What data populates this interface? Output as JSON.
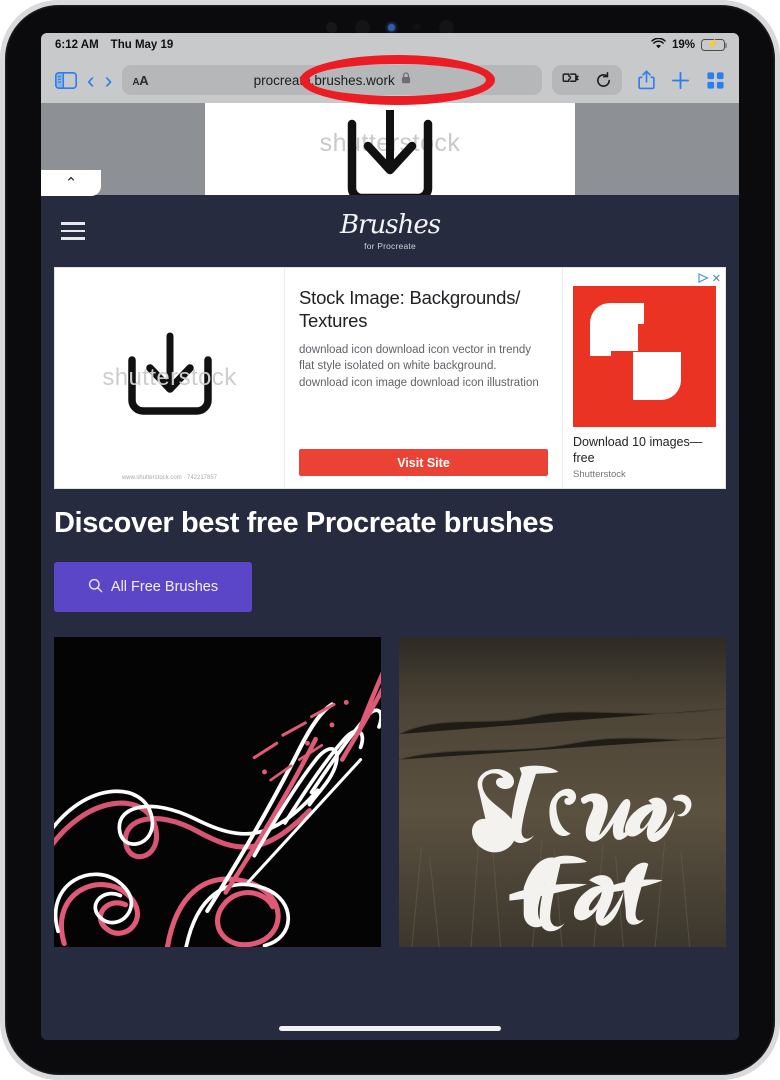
{
  "status_bar": {
    "time": "6:12 AM",
    "date": "Thu May 19",
    "wifi_icon": "wifi-icon",
    "battery_percent": "19%",
    "battery_state": "charging"
  },
  "browser": {
    "sidebar_icon": "sidebar-icon",
    "back_icon": "chevron-left-icon",
    "forward_icon": "chevron-right-icon",
    "text_size_label": "AA",
    "url": "procreate.brushes.work",
    "lock_icon": "lock-icon",
    "extensions_icon": "puzzle-extension-icon",
    "reload_icon": "reload-icon",
    "share_icon": "share-icon",
    "new_tab_icon": "plus-icon",
    "tabs_icon": "tab-overview-icon",
    "annotation": {
      "shape": "ellipse",
      "color": "#ec1c24",
      "target": "url-field"
    }
  },
  "sticky_ad": {
    "watermark": "shutterstock",
    "icon": "download-icon",
    "collapse_icon": "chevron-up-icon"
  },
  "site": {
    "menu_icon": "hamburger-menu-icon",
    "brand_name": "Brushes",
    "brand_subtitle": "for Procreate",
    "headline": "Discover best free Procreate brushes",
    "cta": {
      "label": "All Free Brushes",
      "icon": "search-icon",
      "color": "#5b46c8"
    },
    "background_color": "#262b3f"
  },
  "inline_ad": {
    "image_watermark": "shutterstock",
    "image_caption": "www.shutterstock.com · 742217857",
    "image_icon": "download-icon",
    "title": "Stock Image: Backgrounds/ Textures",
    "description": "download icon download icon vector in trendy flat style isolated on white background. download icon image download icon illustration",
    "cta_label": "Visit Site",
    "cta_color": "#ea4335",
    "right_title": "Download 10 images—free",
    "right_advertiser": "Shutterstock",
    "adchoices_icon": "adchoices-icon",
    "close_icon": "close-icon",
    "logo_color": "#ea3323"
  },
  "cards": [
    {
      "name": "superb-neon-lettering",
      "text": "Superb",
      "style": "neon calligraphy on black"
    },
    {
      "name": "straw-hat-lettering",
      "text_line1": "Straw",
      "text_line2": "Hat",
      "style": "white brush lettering over field photo"
    }
  ],
  "home_indicator": "home-indicator"
}
